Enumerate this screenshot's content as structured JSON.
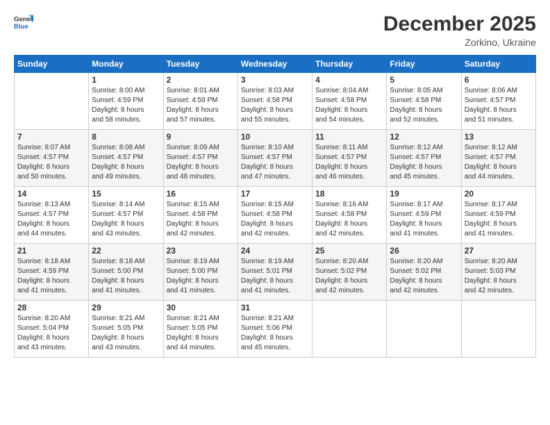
{
  "header": {
    "logo_general": "General",
    "logo_blue": "Blue",
    "month_title": "December 2025",
    "location": "Zorkino, Ukraine"
  },
  "days_of_week": [
    "Sunday",
    "Monday",
    "Tuesday",
    "Wednesday",
    "Thursday",
    "Friday",
    "Saturday"
  ],
  "weeks": [
    [
      {
        "day": "",
        "info": ""
      },
      {
        "day": "1",
        "info": "Sunrise: 8:00 AM\nSunset: 4:59 PM\nDaylight: 8 hours\nand 58 minutes."
      },
      {
        "day": "2",
        "info": "Sunrise: 8:01 AM\nSunset: 4:59 PM\nDaylight: 8 hours\nand 57 minutes."
      },
      {
        "day": "3",
        "info": "Sunrise: 8:03 AM\nSunset: 4:58 PM\nDaylight: 8 hours\nand 55 minutes."
      },
      {
        "day": "4",
        "info": "Sunrise: 8:04 AM\nSunset: 4:58 PM\nDaylight: 8 hours\nand 54 minutes."
      },
      {
        "day": "5",
        "info": "Sunrise: 8:05 AM\nSunset: 4:58 PM\nDaylight: 8 hours\nand 52 minutes."
      },
      {
        "day": "6",
        "info": "Sunrise: 8:06 AM\nSunset: 4:57 PM\nDaylight: 8 hours\nand 51 minutes."
      }
    ],
    [
      {
        "day": "7",
        "info": "Sunrise: 8:07 AM\nSunset: 4:57 PM\nDaylight: 8 hours\nand 50 minutes."
      },
      {
        "day": "8",
        "info": "Sunrise: 8:08 AM\nSunset: 4:57 PM\nDaylight: 8 hours\nand 49 minutes."
      },
      {
        "day": "9",
        "info": "Sunrise: 8:09 AM\nSunset: 4:57 PM\nDaylight: 8 hours\nand 48 minutes."
      },
      {
        "day": "10",
        "info": "Sunrise: 8:10 AM\nSunset: 4:57 PM\nDaylight: 8 hours\nand 47 minutes."
      },
      {
        "day": "11",
        "info": "Sunrise: 8:11 AM\nSunset: 4:57 PM\nDaylight: 8 hours\nand 46 minutes."
      },
      {
        "day": "12",
        "info": "Sunrise: 8:12 AM\nSunset: 4:57 PM\nDaylight: 8 hours\nand 45 minutes."
      },
      {
        "day": "13",
        "info": "Sunrise: 8:12 AM\nSunset: 4:57 PM\nDaylight: 8 hours\nand 44 minutes."
      }
    ],
    [
      {
        "day": "14",
        "info": "Sunrise: 8:13 AM\nSunset: 4:57 PM\nDaylight: 8 hours\nand 44 minutes."
      },
      {
        "day": "15",
        "info": "Sunrise: 8:14 AM\nSunset: 4:57 PM\nDaylight: 8 hours\nand 43 minutes."
      },
      {
        "day": "16",
        "info": "Sunrise: 8:15 AM\nSunset: 4:58 PM\nDaylight: 8 hours\nand 42 minutes."
      },
      {
        "day": "17",
        "info": "Sunrise: 8:15 AM\nSunset: 4:58 PM\nDaylight: 8 hours\nand 42 minutes."
      },
      {
        "day": "18",
        "info": "Sunrise: 8:16 AM\nSunset: 4:58 PM\nDaylight: 8 hours\nand 42 minutes."
      },
      {
        "day": "19",
        "info": "Sunrise: 8:17 AM\nSunset: 4:59 PM\nDaylight: 8 hours\nand 41 minutes."
      },
      {
        "day": "20",
        "info": "Sunrise: 8:17 AM\nSunset: 4:59 PM\nDaylight: 8 hours\nand 41 minutes."
      }
    ],
    [
      {
        "day": "21",
        "info": "Sunrise: 8:18 AM\nSunset: 4:59 PM\nDaylight: 8 hours\nand 41 minutes."
      },
      {
        "day": "22",
        "info": "Sunrise: 8:18 AM\nSunset: 5:00 PM\nDaylight: 8 hours\nand 41 minutes."
      },
      {
        "day": "23",
        "info": "Sunrise: 8:19 AM\nSunset: 5:00 PM\nDaylight: 8 hours\nand 41 minutes."
      },
      {
        "day": "24",
        "info": "Sunrise: 8:19 AM\nSunset: 5:01 PM\nDaylight: 8 hours\nand 41 minutes."
      },
      {
        "day": "25",
        "info": "Sunrise: 8:20 AM\nSunset: 5:02 PM\nDaylight: 8 hours\nand 42 minutes."
      },
      {
        "day": "26",
        "info": "Sunrise: 8:20 AM\nSunset: 5:02 PM\nDaylight: 8 hours\nand 42 minutes."
      },
      {
        "day": "27",
        "info": "Sunrise: 8:20 AM\nSunset: 5:03 PM\nDaylight: 8 hours\nand 42 minutes."
      }
    ],
    [
      {
        "day": "28",
        "info": "Sunrise: 8:20 AM\nSunset: 5:04 PM\nDaylight: 8 hours\nand 43 minutes."
      },
      {
        "day": "29",
        "info": "Sunrise: 8:21 AM\nSunset: 5:05 PM\nDaylight: 8 hours\nand 43 minutes."
      },
      {
        "day": "30",
        "info": "Sunrise: 8:21 AM\nSunset: 5:05 PM\nDaylight: 8 hours\nand 44 minutes."
      },
      {
        "day": "31",
        "info": "Sunrise: 8:21 AM\nSunset: 5:06 PM\nDaylight: 8 hours\nand 45 minutes."
      },
      {
        "day": "",
        "info": ""
      },
      {
        "day": "",
        "info": ""
      },
      {
        "day": "",
        "info": ""
      }
    ]
  ]
}
